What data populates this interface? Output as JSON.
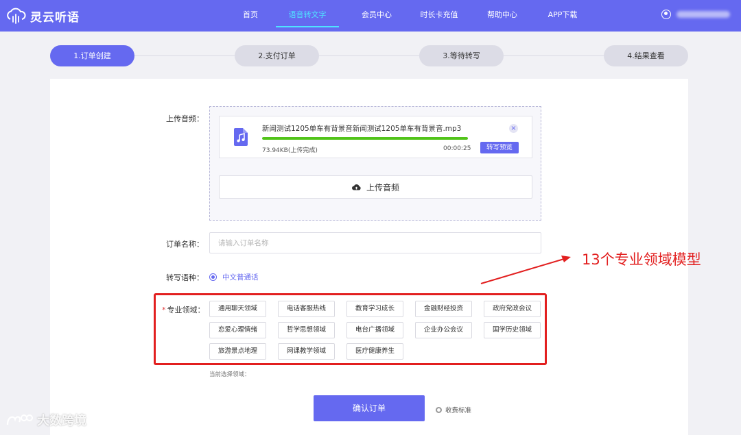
{
  "brand": {
    "name": "灵云听语",
    "color": "#6569f0",
    "icon": "cloud-sound-logo-icon"
  },
  "nav": {
    "items": [
      {
        "label": "首页",
        "active": false
      },
      {
        "label": "语音转文字",
        "active": true
      },
      {
        "label": "会员中心",
        "active": false
      },
      {
        "label": "时长卡充值",
        "active": false
      },
      {
        "label": "帮助中心",
        "active": false
      },
      {
        "label": "APP下载",
        "active": false
      }
    ],
    "active_color": "#4fe3ff"
  },
  "user": {
    "icon": "user-icon"
  },
  "steps": [
    {
      "label": "1.订单创建",
      "active": true
    },
    {
      "label": "2.支付订单",
      "active": false
    },
    {
      "label": "3.等待转写",
      "active": false
    },
    {
      "label": "4.结果查看",
      "active": false
    }
  ],
  "form": {
    "upload_label": "上传音频：",
    "file": {
      "name": "新闻测试1205单车有背景音新闻测试1205单车有背景音.mp3",
      "size_status": "73.94KB(上传完成)",
      "duration": "00:00:25",
      "progress": 1.0,
      "preview_label": "转写预览",
      "icon": "music-file-icon",
      "progress_color": "#52c41a"
    },
    "upload_button": "上传音频",
    "order_name_label": "订单名称：",
    "order_name_placeholder": "请输入订单名称",
    "order_name_value": "",
    "language_label": "转写语种：",
    "language_option": "中文普通话",
    "domain_label": "专业领域：",
    "domain_required_mark": "*",
    "domains": [
      "通用聊天领域",
      "电话客服热线",
      "教育学习成长",
      "金融财经投资",
      "政府党政会议",
      "恋爱心理情绪",
      "哲学思想领域",
      "电台广播领域",
      "企业办公会议",
      "国学历史领域",
      "旅游景点地理",
      "网课教学领域",
      "医疗健康养生"
    ],
    "current_selection": "当前选择领域：",
    "confirm_button": "确认订单",
    "fee_label": "收费标准"
  },
  "annotation": {
    "text": "13个专业领域模型",
    "color": "#e21f1f"
  },
  "watermark": {
    "text": "大数跨境"
  }
}
